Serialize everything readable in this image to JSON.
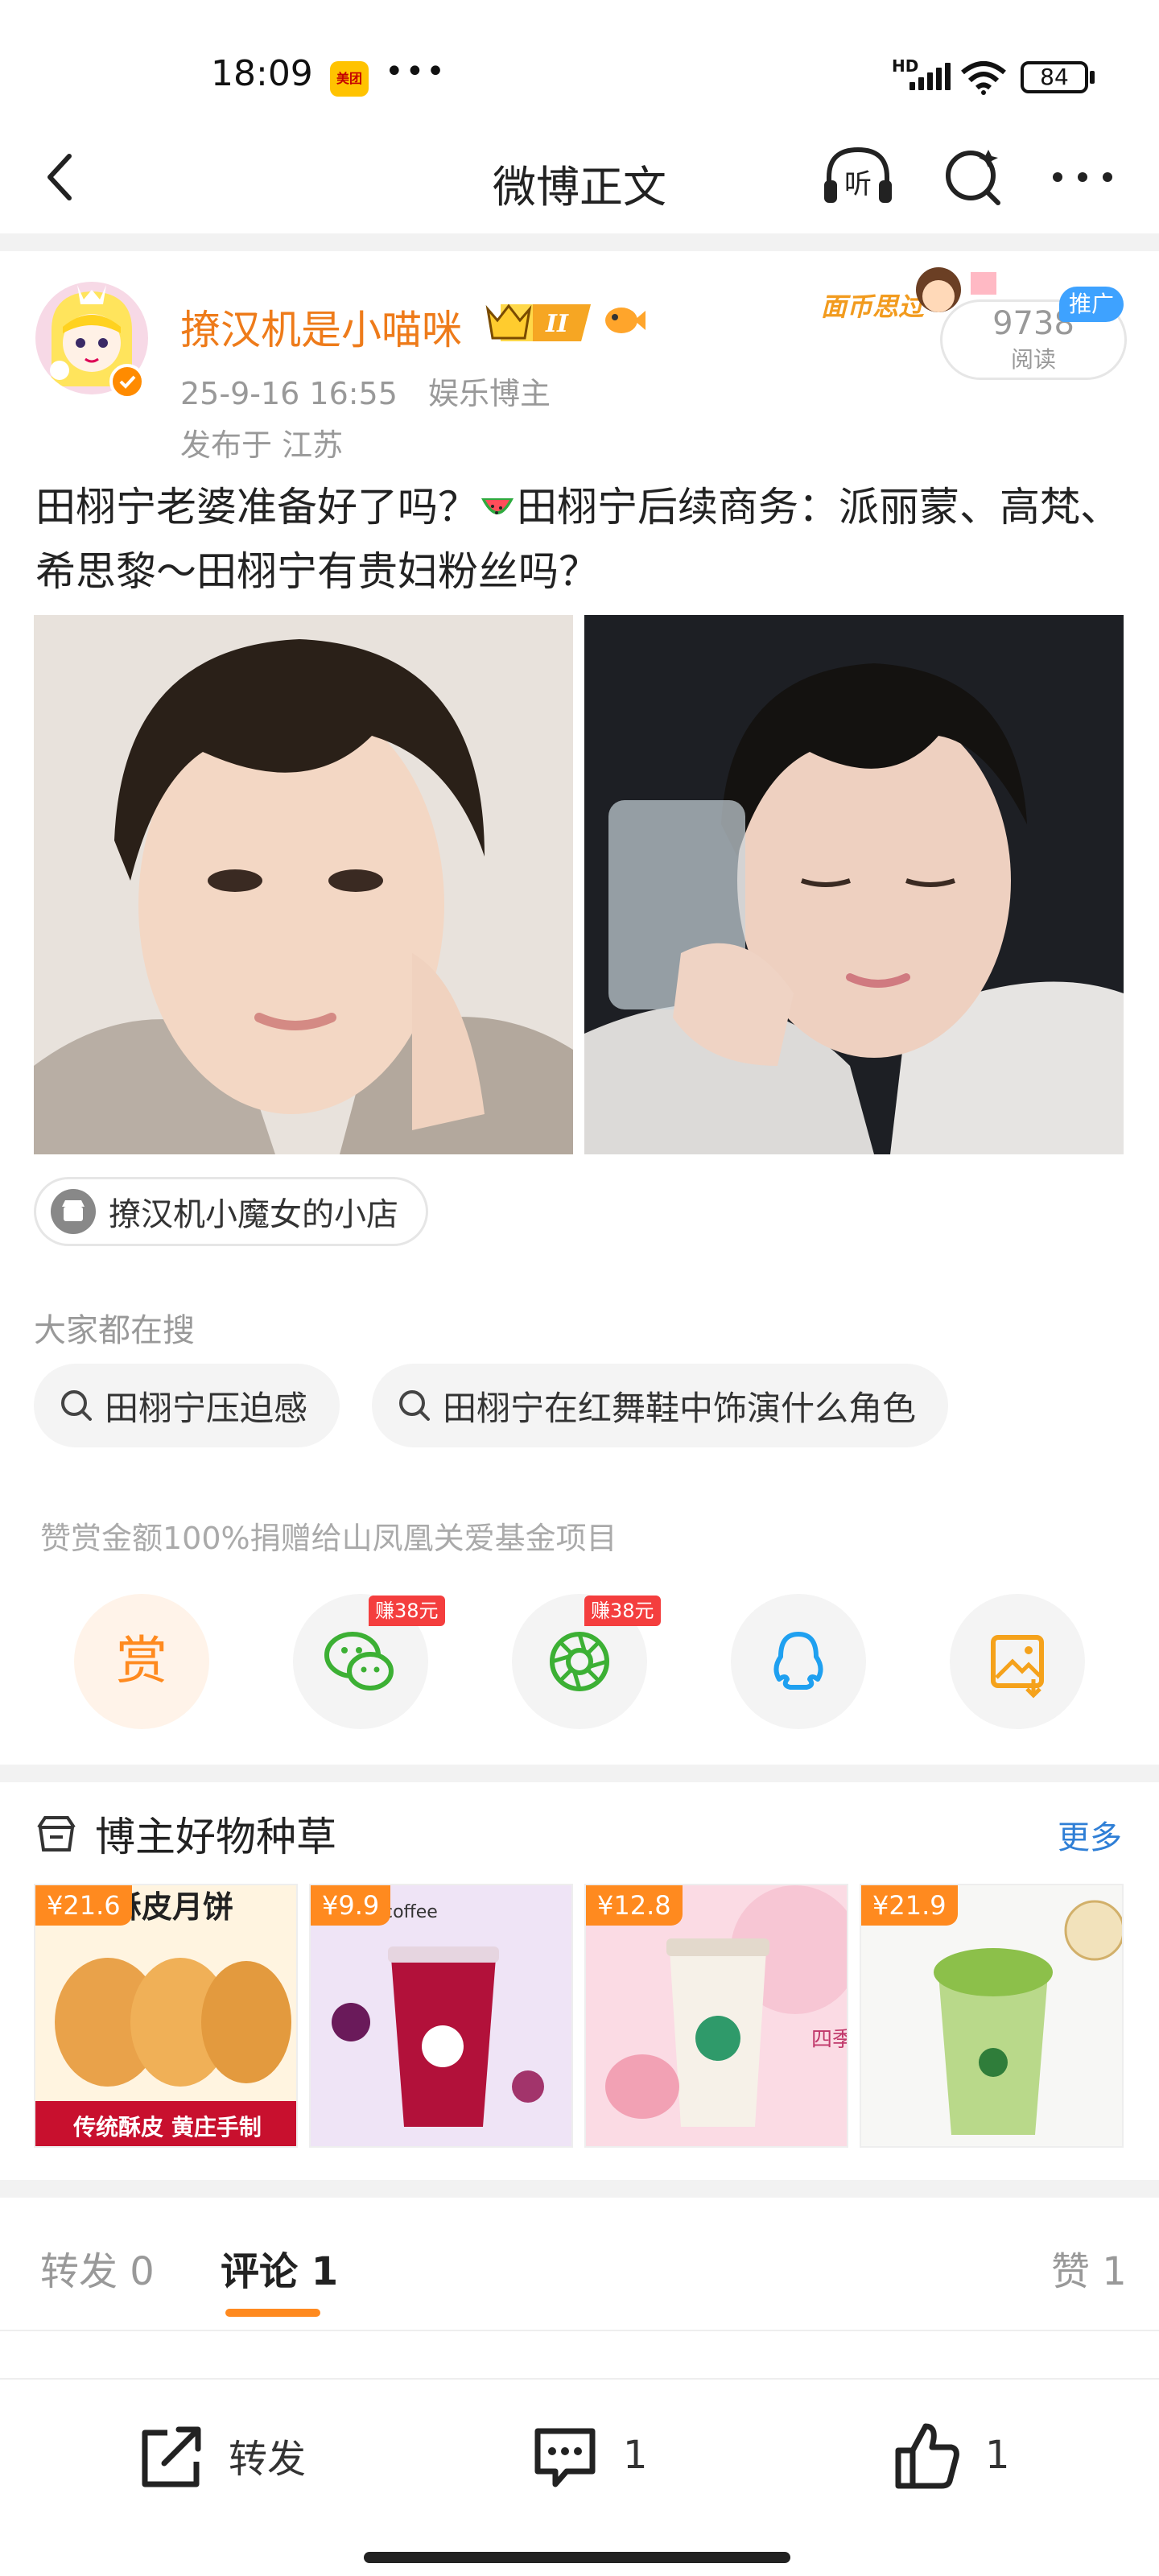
{
  "status_bar": {
    "time": "18:09",
    "app_badge": "美团",
    "overflow": "•••",
    "network": "HD",
    "battery": "84"
  },
  "nav": {
    "title": "微博正文",
    "icons": [
      "back-icon",
      "listen-icon",
      "search-icon",
      "more-icon"
    ]
  },
  "post": {
    "username": "撩汉机是小喵咪",
    "vip_level": "II",
    "time": "25-9-16 16:55",
    "category": "娱乐博主",
    "location": "发布于 江苏",
    "reads": "9738",
    "reads_label": "阅读",
    "promo_tag": "推广",
    "text_part1": "田栩宁老婆准备好了吗？",
    "text_part2": "田栩宁后续商务：派丽蒙、高梵、希思黎～田栩宁有贵妇粉丝吗？",
    "shop_label": "撩汉机小魔女的小店"
  },
  "search": {
    "title": "大家都在搜",
    "chips": [
      "田栩宁压迫感",
      "田栩宁在红舞鞋中饰演什么角色"
    ]
  },
  "donate": {
    "text": "赞赏金额100%捐赠给山凤凰关爱基金项目",
    "reward_label": "赏",
    "earn1": "赚38元",
    "earn2": "赚38元"
  },
  "products": {
    "title": "博主好物种草",
    "more": "更多",
    "items": [
      {
        "price": "¥21.6"
      },
      {
        "price": "¥9.9"
      },
      {
        "price": "¥12.8"
      },
      {
        "price": "¥21.9"
      }
    ]
  },
  "tabs": {
    "repost": "转发 0",
    "comment": "评论 1",
    "like": "赞 1"
  },
  "bottom": {
    "repost_label": "转发",
    "comment_count": "1",
    "like_count": "1"
  },
  "colors": {
    "accent": "#ff8a1f",
    "username": "#ee7b1a",
    "link": "#2f7fd6",
    "promo": "#3ea2ff"
  }
}
